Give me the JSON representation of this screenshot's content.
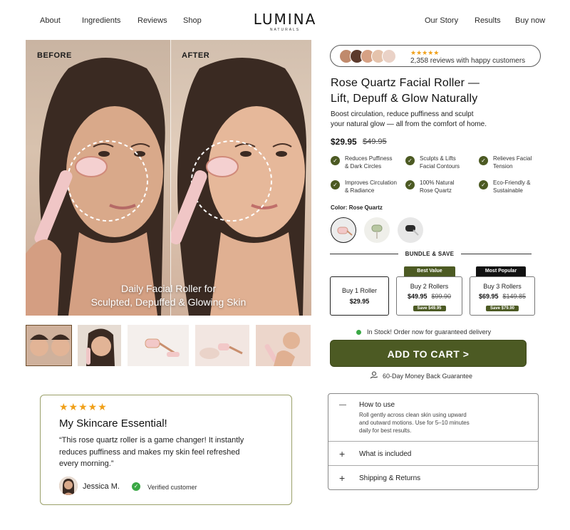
{
  "nav": {
    "left": [
      "About",
      "Ingredients",
      "Reviews",
      "Shop"
    ],
    "right": [
      "Our Story",
      "Results",
      "Buy now"
    ],
    "logo": "LUMINA",
    "logo_sub": "NATURALS"
  },
  "hero": {
    "before_label": "BEFORE",
    "after_label": "AFTER",
    "caption_line1": "Daily Facial Roller for",
    "caption_line2": "Sculpted, Depuffed & Glowing Skin"
  },
  "reviews_pill": {
    "stars": "★★★★★",
    "text": "2,358 reviews with happy customers"
  },
  "product": {
    "title_line1": "Rose Quartz Facial Roller —",
    "title_line2": "Lift, Depuff & Glow Naturally",
    "subtitle_line1": "Boost circulation, reduce puffiness and sculpt",
    "subtitle_line2": "your natural glow — all from the comfort of home.",
    "price": "$29.95",
    "old_price": "$49.95"
  },
  "features": [
    {
      "line1": "Reduces Puffiness",
      "line2": "& Dark Circles"
    },
    {
      "line1": "Sculpts & Lifts",
      "line2": "Facial Contours"
    },
    {
      "line1": "Relieves Facial",
      "line2": "Tension"
    },
    {
      "line1": "Improves Circulation",
      "line2": "& Radiance"
    },
    {
      "line1": "100% Natural",
      "line2": "Rose Quartz"
    },
    {
      "line1": "Eco-Friendly &",
      "line2": "Sustainable"
    }
  ],
  "color": {
    "label": "Color: Rose Quartz",
    "swatches": [
      "rose-quartz",
      "jade",
      "black-obsidian"
    ]
  },
  "bundle": {
    "title": "BUNDLE & SAVE",
    "options": [
      {
        "name": "Buy 1 Roller",
        "price": "$29.95",
        "old": "",
        "save": "",
        "tag": ""
      },
      {
        "name": "Buy 2 Rollers",
        "price": "$49.95",
        "old": "$99.90",
        "save": "Save $49.95",
        "tag": "Best Value"
      },
      {
        "name": "Buy 3 Rollers",
        "price": "$69.95",
        "old": "$149.85",
        "save": "Save $79.90",
        "tag": "Most Popular"
      }
    ]
  },
  "stock_text": "In Stock! Order now for guaranteed delivery",
  "cart_button": "ADD TO CART   >",
  "guarantee": "60-Day Money Back Guarantee",
  "accordion": {
    "how_title": "How to use",
    "how_body1": "Roll gently across clean skin using upward",
    "how_body2": "and outward motions. Use for 5–10 minutes",
    "how_body3": "daily for best results.",
    "included_title": "What is included",
    "shipping_title": "Shipping & Returns",
    "minus": "—",
    "plus": "+"
  },
  "testimonial": {
    "stars": "★★★★★",
    "title": "My Skincare Essential!",
    "quote_line1": "“This rose quartz roller is a game changer! It instantly",
    "quote_line2": "reduces puffiness and makes my skin feel refreshed",
    "quote_line3": "every morning.”",
    "name": "Jessica M.",
    "verified": "Verified customer"
  },
  "colors": {
    "accent": "#4c5a23",
    "star": "#f0a019",
    "stock": "#3aa845"
  }
}
